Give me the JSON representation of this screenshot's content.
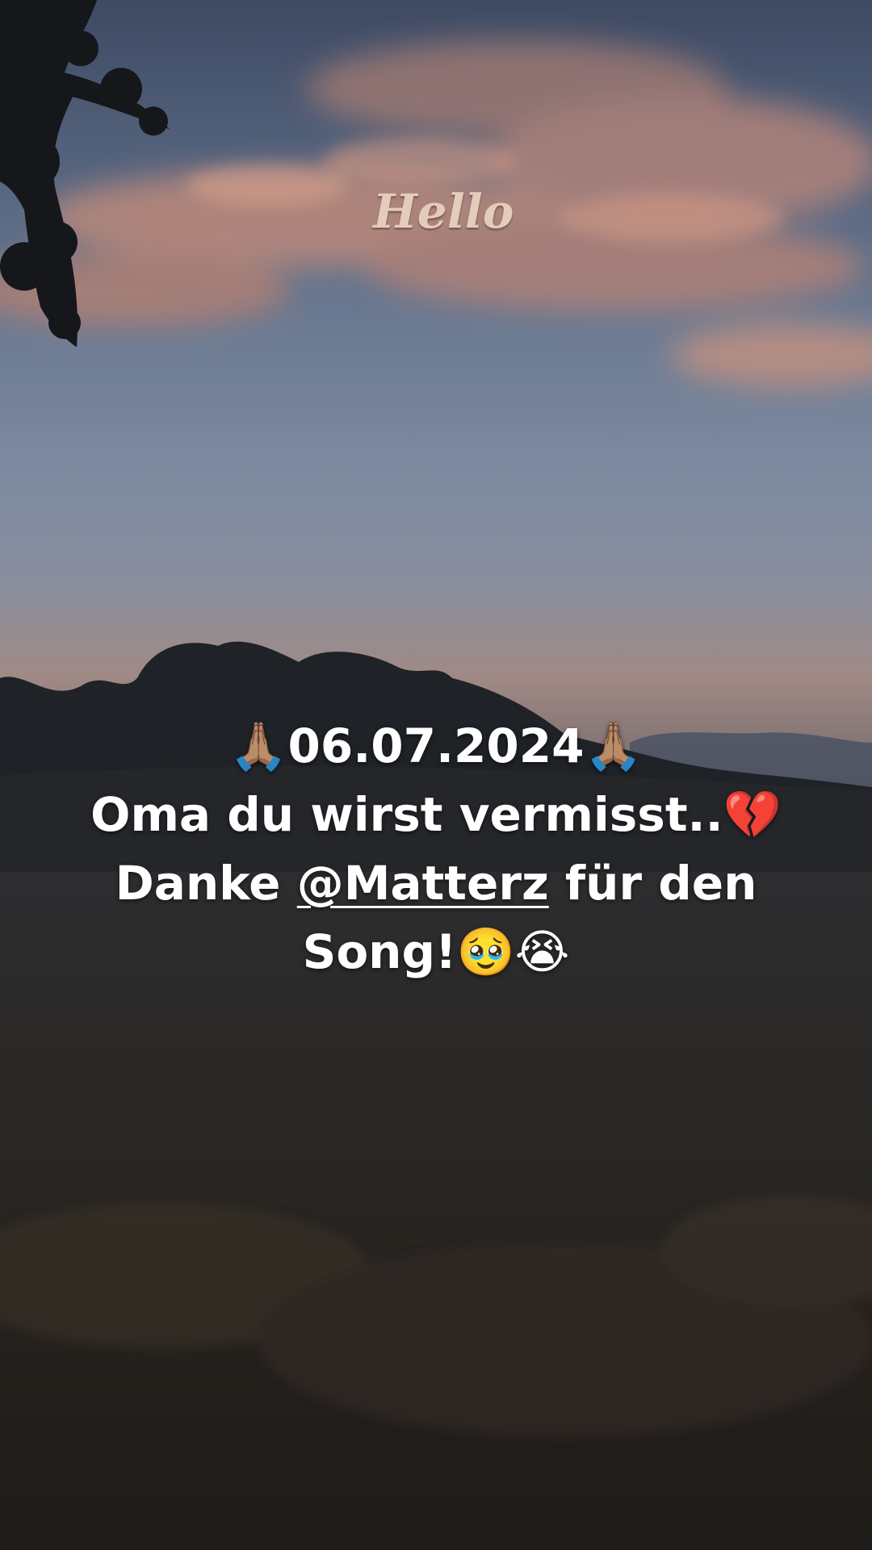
{
  "overlay_text": {
    "hello": "Hello",
    "line1": "🙏🏽06.07.2024🙏🏽",
    "line2": "Oma du wirst vermisst..💔",
    "line3_prefix": "Danke ",
    "line3_mention": "@Matterz",
    "line3_suffix": " für den",
    "line4": "Song!🥹😭"
  },
  "colors": {
    "caption": "#ffffff",
    "hello": "#e9d3c0",
    "sky_top": "#3e4a63",
    "horizon": "#a08a85",
    "ground": "#2a2826"
  },
  "icons": [
    "folded-hands-icon",
    "broken-heart-icon",
    "pleading-face-icon",
    "crying-face-icon"
  ]
}
